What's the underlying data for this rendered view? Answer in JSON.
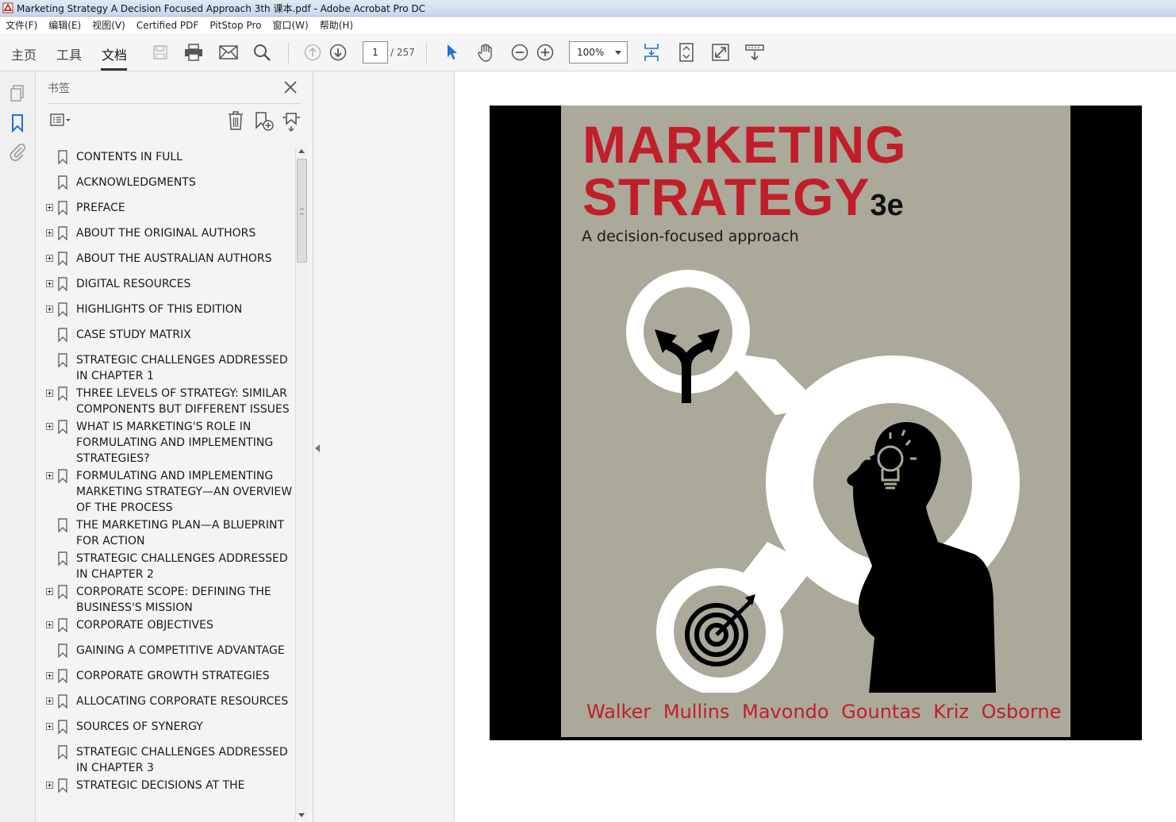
{
  "window": {
    "title": "Marketing Strategy A Decision Focused Approach 3th 课本.pdf - Adobe Acrobat Pro DC"
  },
  "menu": {
    "items": [
      "文件(F)",
      "编辑(E)",
      "视图(V)",
      "Certified PDF",
      "PitStop Pro",
      "窗口(W)",
      "帮助(H)"
    ]
  },
  "toolbar": {
    "tabs": [
      "主页",
      "工具",
      "文档"
    ],
    "active_tab": "文档",
    "page_current": "1",
    "page_total": "/ 257",
    "zoom": "100%"
  },
  "bookmarks": {
    "header": "书签",
    "items": [
      {
        "label": "CONTENTS IN FULL",
        "expandable": false
      },
      {
        "label": "ACKNOWLEDGMENTS",
        "expandable": false
      },
      {
        "label": "PREFACE",
        "expandable": true
      },
      {
        "label": "ABOUT THE ORIGINAL AUTHORS",
        "expandable": true
      },
      {
        "label": "ABOUT THE AUSTRALIAN AUTHORS",
        "expandable": true
      },
      {
        "label": "DIGITAL RESOURCES",
        "expandable": true
      },
      {
        "label": "HIGHLIGHTS OF THIS EDITION",
        "expandable": true
      },
      {
        "label": "CASE STUDY MATRIX",
        "expandable": false
      },
      {
        "label": "STRATEGIC CHALLENGES ADDRESSED IN CHAPTER 1",
        "expandable": false
      },
      {
        "label": "THREE LEVELS OF STRATEGY: SIMILAR COMPONENTS BUT DIFFERENT ISSUES",
        "expandable": true
      },
      {
        "label": "WHAT IS MARKETING'S ROLE IN FORMULATING AND IMPLEMENTING STRATEGIES?",
        "expandable": true
      },
      {
        "label": "FORMULATING AND IMPLEMENTING MARKETING STRATEGY—AN OVERVIEW OF THE PROCESS",
        "expandable": true
      },
      {
        "label": "THE MARKETING PLAN—A BLUEPRINT FOR ACTION",
        "expandable": false
      },
      {
        "label": "STRATEGIC CHALLENGES ADDRESSED IN CHAPTER 2",
        "expandable": false
      },
      {
        "label": "CORPORATE SCOPE: DEFINING THE BUSINESS'S MISSION",
        "expandable": true
      },
      {
        "label": "CORPORATE OBJECTIVES",
        "expandable": true
      },
      {
        "label": "GAINING A COMPETITIVE ADVANTAGE",
        "expandable": false
      },
      {
        "label": "CORPORATE GROWTH STRATEGIES",
        "expandable": true
      },
      {
        "label": "ALLOCATING CORPORATE RESOURCES",
        "expandable": true
      },
      {
        "label": "SOURCES OF SYNERGY",
        "expandable": true
      },
      {
        "label": "STRATEGIC CHALLENGES ADDRESSED IN CHAPTER 3",
        "expandable": false
      },
      {
        "label": "STRATEGIC DECISIONS AT THE",
        "expandable": true
      }
    ]
  },
  "cover": {
    "title_line1": "MARKETING",
    "title_line2": "STRATEGY",
    "edition": "3e",
    "subtitle": "A decision-focused approach",
    "authors": "Walker  Mullins  Mavondo  Gountas  Kriz  Osborne",
    "colors": {
      "title": "#c21e2a",
      "background": "#aaa99a"
    }
  }
}
